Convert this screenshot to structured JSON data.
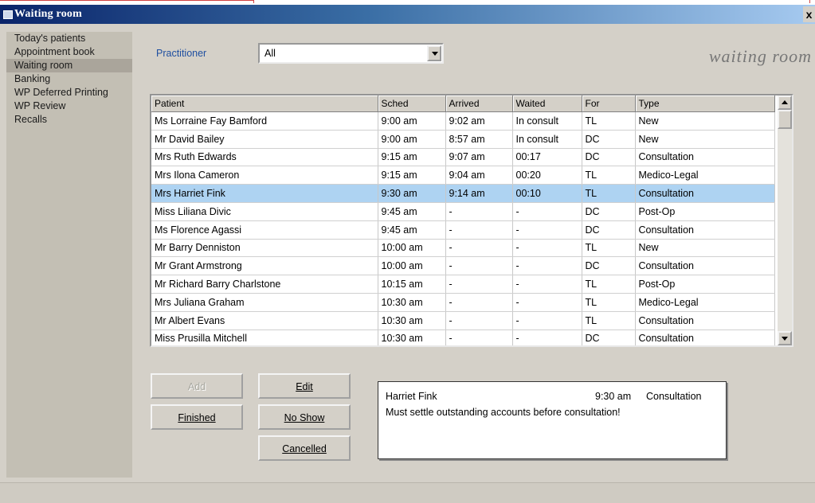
{
  "window": {
    "title": "Waiting room",
    "close_label": "x"
  },
  "sidebar": {
    "items": [
      {
        "label": "Today's patients"
      },
      {
        "label": "Appointment book"
      },
      {
        "label": "Waiting room",
        "active": true
      },
      {
        "label": "Banking"
      },
      {
        "label": "WP Deferred Printing"
      },
      {
        "label": "WP Review"
      },
      {
        "label": "Recalls"
      }
    ]
  },
  "filter": {
    "label": "Practitioner",
    "value": "All"
  },
  "brand": "waiting room",
  "table": {
    "headers": [
      "Patient",
      "Sched",
      "Arrived",
      "Waited",
      "For",
      "Type"
    ],
    "rows": [
      [
        "Ms Lorraine Fay Bamford",
        "9:00 am",
        "9:02 am",
        "In consult",
        "TL",
        "New"
      ],
      [
        "Mr David Bailey",
        "9:00 am",
        "8:57 am",
        "In consult",
        "DC",
        "New"
      ],
      [
        "Mrs Ruth Edwards",
        "9:15 am",
        "9:07 am",
        "00:17",
        "DC",
        "Consultation"
      ],
      [
        "Mrs Ilona Cameron",
        "9:15 am",
        "9:04 am",
        "00:20",
        "TL",
        "Medico-Legal"
      ],
      [
        "Mrs Harriet Fink",
        "9:30 am",
        "9:14 am",
        "00:10",
        "TL",
        "Consultation"
      ],
      [
        "Miss Liliana Divic",
        "9:45 am",
        "-",
        "-",
        "DC",
        "Post-Op"
      ],
      [
        "Ms Florence Agassi",
        "9:45 am",
        "-",
        "-",
        "DC",
        "Consultation"
      ],
      [
        "Mr Barry Denniston",
        "10:00 am",
        "-",
        "-",
        "TL",
        "New"
      ],
      [
        "Mr Grant Armstrong",
        "10:00 am",
        "-",
        "-",
        "DC",
        "Consultation"
      ],
      [
        "Mr Richard Barry Charlstone",
        "10:15 am",
        "-",
        "-",
        "TL",
        "Post-Op"
      ],
      [
        "Mrs Juliana Graham",
        "10:30 am",
        "-",
        "-",
        "TL",
        "Medico-Legal"
      ],
      [
        "Mr Albert Evans",
        "10:30 am",
        "-",
        "-",
        "TL",
        "Consultation"
      ],
      [
        "Miss Prusilla Mitchell",
        "10:30 am",
        "-",
        "-",
        "DC",
        "Consultation"
      ]
    ],
    "selected_row": 4
  },
  "buttons": {
    "add": "Add",
    "edit": "Edit",
    "finished": "Finished",
    "no_show": "No Show",
    "cancelled": "Cancelled"
  },
  "notes": {
    "name": "Harriet Fink",
    "time": "9:30 am",
    "type": "Consultation",
    "message": "Must settle outstanding accounts before consultation!"
  }
}
